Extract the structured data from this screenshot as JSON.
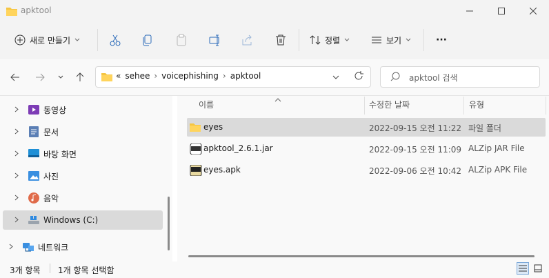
{
  "window": {
    "title": "apktool",
    "controls": [
      "minimize-icon",
      "maximize-icon",
      "close-icon"
    ]
  },
  "toolbar": {
    "new_label": "새로 만들기",
    "sort_label": "정렬",
    "view_label": "보기",
    "more_label": "···",
    "icons": [
      "cut-icon",
      "copy-icon",
      "paste-icon",
      "rename-icon",
      "share-icon",
      "delete-icon"
    ]
  },
  "address": {
    "overflow": "«",
    "crumbs": [
      "sehee",
      "voicephishing",
      "apktool"
    ],
    "separator": "›"
  },
  "search": {
    "placeholder": "apktool 검색"
  },
  "sidebar": {
    "items": [
      {
        "label": "동영상",
        "icon": "video-folder-icon"
      },
      {
        "label": "문서",
        "icon": "documents-folder-icon"
      },
      {
        "label": "바탕 화면",
        "icon": "desktop-folder-icon"
      },
      {
        "label": "사진",
        "icon": "pictures-folder-icon"
      },
      {
        "label": "음악",
        "icon": "music-folder-icon"
      },
      {
        "label": "Windows (C:)",
        "icon": "drive-icon",
        "selected": true
      },
      {
        "label": "네트워크",
        "icon": "network-icon"
      }
    ]
  },
  "columns": {
    "name": "이름",
    "date": "수정한 날짜",
    "type": "유형"
  },
  "files": [
    {
      "name": "eyes",
      "date": "2022-09-15 오전 11:22",
      "type": "파일 폴더",
      "icon": "folder-icon",
      "selected": true
    },
    {
      "name": "apktool_2.6.1.jar",
      "date": "2022-09-15 오전 11:09",
      "type": "ALZip JAR File",
      "icon": "jar-file-icon"
    },
    {
      "name": "eyes.apk",
      "date": "2022-09-06 오전 10:42",
      "type": "ALZip APK File",
      "icon": "apk-file-icon"
    }
  ],
  "status": {
    "count": "3개 항목",
    "selection": "1개 항목 선택함"
  },
  "colors": {
    "folder": "#f5c542",
    "selection": "#dadada",
    "accent": "#0067c0"
  }
}
